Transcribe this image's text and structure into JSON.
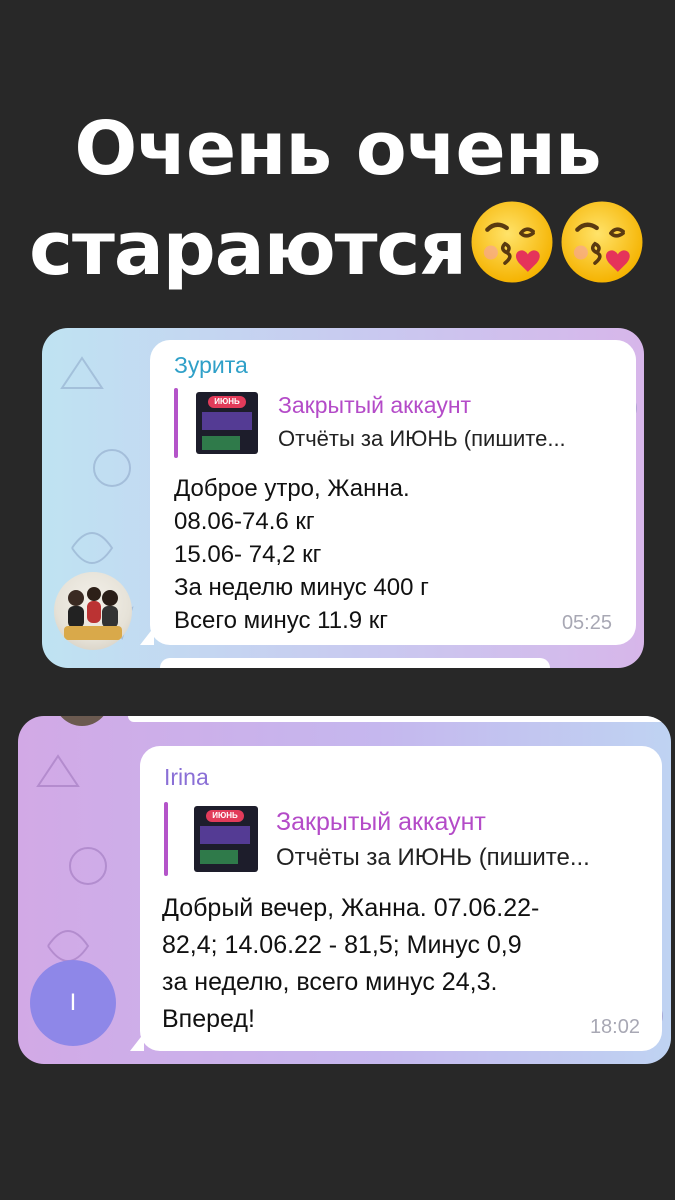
{
  "headline": {
    "line1": "Очень очень",
    "line2": "стараются",
    "emoji_icon": "kissing-face-with-heart-icon"
  },
  "messages": [
    {
      "sender": "Зурита",
      "sender_color": "#2fa0c8",
      "reply": {
        "thumb_badge": "ИЮНЬ",
        "title": "Закрытый аккаунт",
        "subtitle": "Отчёты за ИЮНЬ  (пишите..."
      },
      "lines": [
        "Доброе утро, Жанна.",
        "08.06-74.6 кг",
        "15.06- 74,2 кг",
        "За неделю минус 400 г",
        "Всего минус 11.9 кг"
      ],
      "time": "05:25",
      "avatar_icon": "family-photo-avatar"
    },
    {
      "sender": "Irina",
      "sender_color": "#8a6fd6",
      "reply": {
        "thumb_badge": "ИЮНЬ",
        "title": "Закрытый аккаунт",
        "subtitle": "Отчёты за ИЮНЬ  (пишите..."
      },
      "lines": [
        "Добрый вечер, Жанна. 07.06.22-",
        "82,4; 14.06.22 - 81,5; Минус 0,9",
        "за неделю, всего минус 24,3.",
        "Вперед!"
      ],
      "time": "18:02",
      "avatar_letter": "I",
      "avatar_color": "#8e87e8"
    }
  ]
}
